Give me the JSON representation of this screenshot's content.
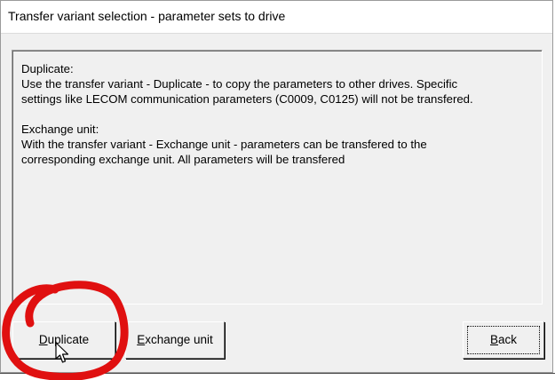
{
  "window": {
    "title": "Transfer variant selection - parameter sets to drive"
  },
  "info": {
    "duplicate_heading": "Duplicate:",
    "duplicate_line1": "Use the transfer variant - Duplicate - to copy the parameters to other drives. Specific",
    "duplicate_line2": "settings like LECOM communication parameters (C0009, C0125) will not be transfered.",
    "exchange_heading": "Exchange unit:",
    "exchange_line1": "With the transfer variant - Exchange unit - parameters can be transfered to the",
    "exchange_line2": "corresponding exchange unit. All parameters will be transfered"
  },
  "buttons": {
    "duplicate": {
      "mnemonic": "D",
      "rest": "uplicate"
    },
    "exchange": {
      "mnemonic": "E",
      "rest": "xchange unit"
    },
    "back": {
      "mnemonic": "B",
      "rest": "ack"
    }
  },
  "annotation": {
    "color": "#e01010",
    "marks": "red hand-drawn circle around Duplicate button"
  },
  "cursor": {
    "icon": "mouse-pointer-icon"
  }
}
